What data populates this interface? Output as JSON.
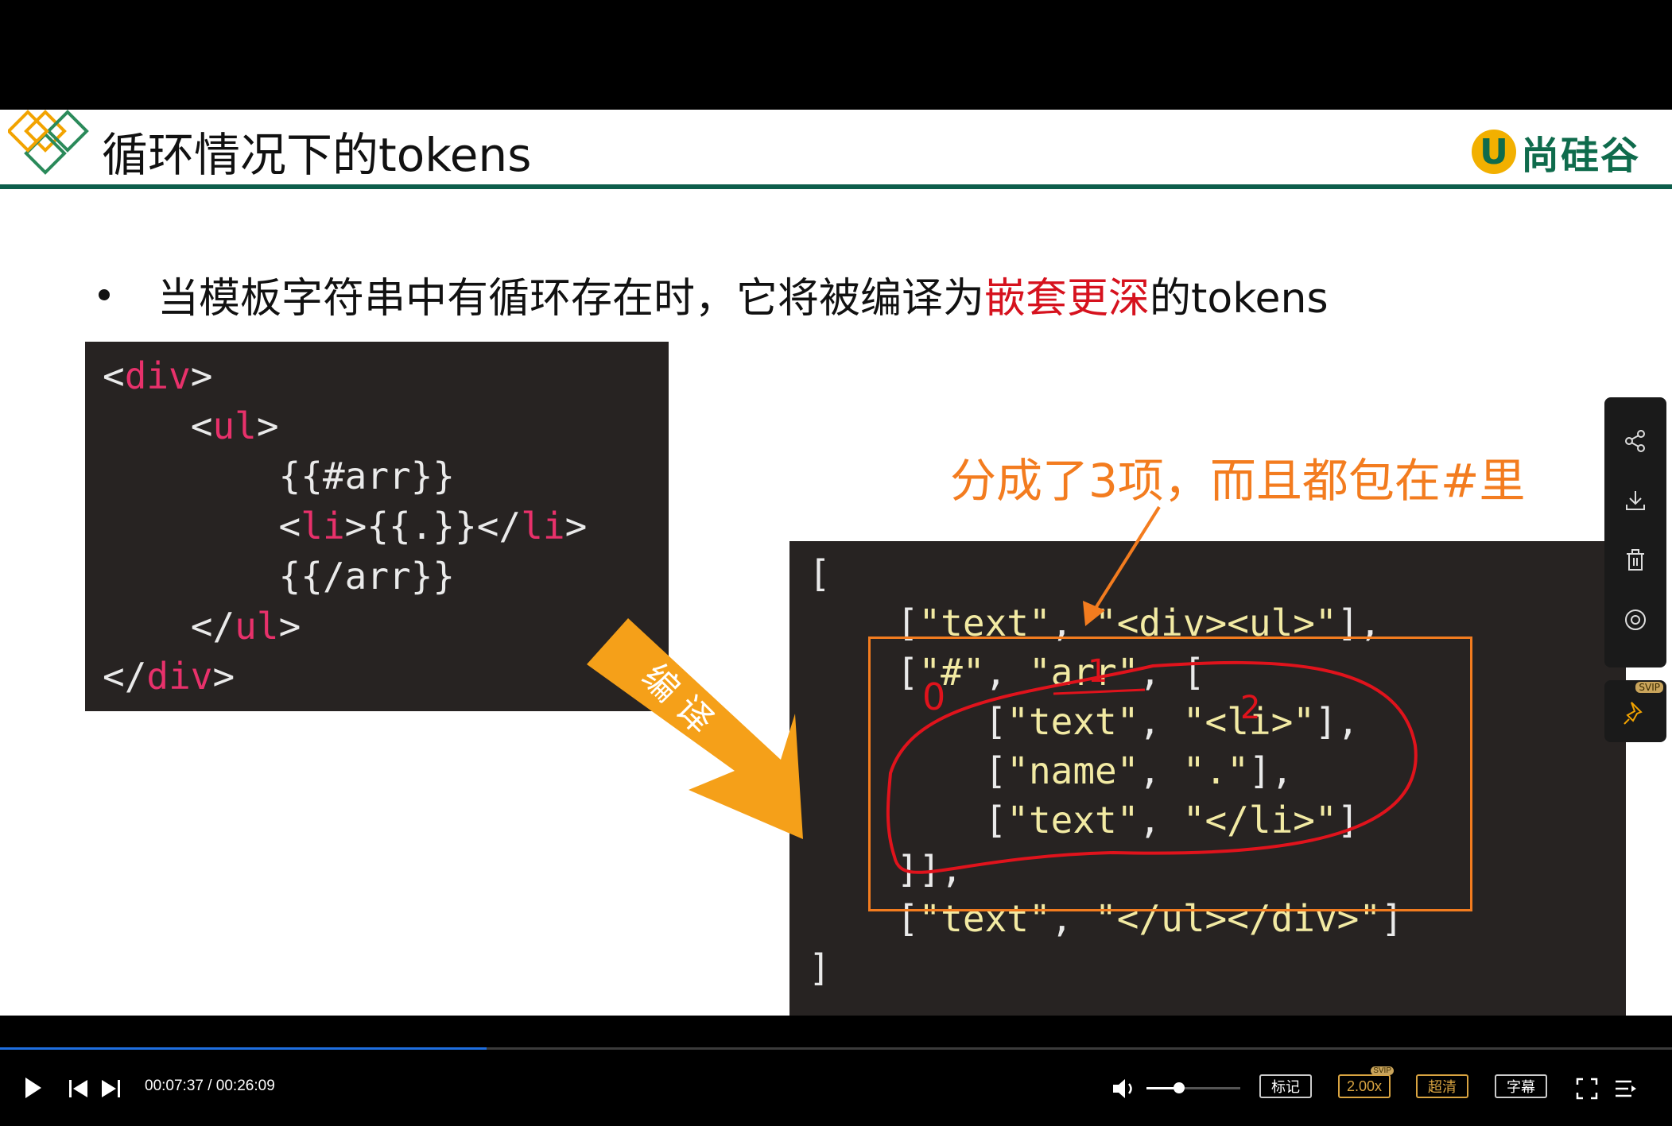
{
  "slide": {
    "title": "循环情况下的tokens",
    "brand": "尚硅谷",
    "bullet": {
      "before": "当模板字符串中有循环存在时，它将被编译为",
      "highlight": "嵌套更深",
      "after": "的tokens"
    },
    "compile_label_1": "编",
    "compile_label_2": "译",
    "annotation": "分成了3项，而且都包在#里",
    "template_code": [
      [
        "<",
        "div",
        ">"
      ],
      [
        "    <",
        "ul",
        ">"
      ],
      [
        "        {{#arr}}",
        "",
        ""
      ],
      [
        "        <",
        "li",
        ">{{.}}</",
        "li",
        ">"
      ],
      [
        "        {{/arr}}",
        "",
        ""
      ],
      [
        "    </",
        "ul",
        ">"
      ],
      [
        "</",
        "div",
        ">"
      ]
    ],
    "tokens_code": [
      "[",
      "    [\"text\", \"<div><ul>\"],",
      "    [\"#\", \"arr\", [",
      "        [\"text\", \"<li>\"],",
      "        [\"name\", \".\"],",
      "        [\"text\", \"</li>\"]",
      "    ]],",
      "    [\"text\", \"</ul></div>\"]",
      "]"
    ],
    "handwritten_marks": [
      "0",
      "1",
      "2"
    ]
  },
  "sidebar": {
    "icons": [
      "share-icon",
      "download-icon",
      "delete-icon",
      "eye-icon"
    ],
    "pin_badge": "SVIP"
  },
  "player": {
    "current_time": "00:07:37",
    "duration": "00:26:09",
    "time_display": "00:07:37 / 00:26:09",
    "progress_fraction": 0.291,
    "volume_fraction": 0.35,
    "mark_label": "标记",
    "speed_label": "2.00x",
    "speed_badge": "SVIP",
    "quality_label": "超清",
    "subtitle_label": "字幕",
    "accent_color": "#1f6fe0"
  }
}
